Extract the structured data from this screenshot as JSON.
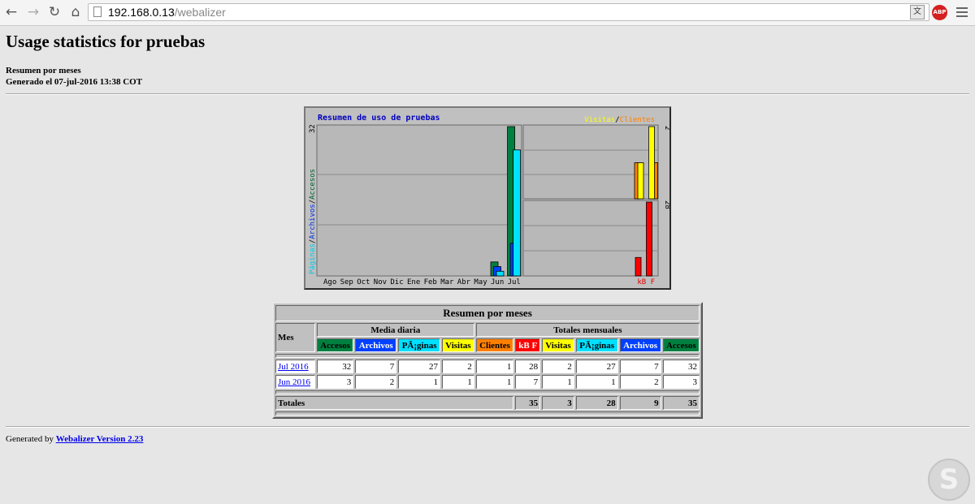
{
  "browser": {
    "url_host": "192.168.0.13",
    "url_path": "/webalizer",
    "icons": [
      "back-icon",
      "forward-icon",
      "reload-icon",
      "home-icon",
      "translate-icon",
      "adblock-icon",
      "menu-icon"
    ]
  },
  "page": {
    "title": "Usage statistics for pruebas",
    "subtitle1": "Resumen por meses",
    "subtitle2": "Generado el 07-jul-2016 13:38 COT"
  },
  "graph": {
    "title": "Resumen de uso de pruebas",
    "legend_visitas": "Visitas",
    "legend_sep": "/",
    "legend_clientes": "Clientes",
    "left_axis_paginas": "Páginas",
    "left_axis_archivos": "Archivos",
    "left_axis_accesos": "Accesos",
    "left_axis_max": "32",
    "visits_axis_max": "2",
    "kb_axis_max": "28",
    "kb_label": "kB F",
    "months": [
      "Ago",
      "Sep",
      "Oct",
      "Nov",
      "Dic",
      "Ene",
      "Feb",
      "Mar",
      "Abr",
      "May",
      "Jun",
      "Jul"
    ]
  },
  "chart_data": {
    "type": "bar",
    "title": "Resumen de uso de pruebas",
    "categories": [
      "Ago",
      "Sep",
      "Oct",
      "Nov",
      "Dic",
      "Ene",
      "Feb",
      "Mar",
      "Abr",
      "May",
      "Jun",
      "Jul"
    ],
    "panels": [
      {
        "name": "Accesos / Archivos / Páginas",
        "ylim": [
          0,
          32
        ],
        "series": [
          {
            "name": "Accesos",
            "color": "#008040",
            "values": [
              0,
              0,
              0,
              0,
              0,
              0,
              0,
              0,
              0,
              0,
              3,
              32
            ]
          },
          {
            "name": "Archivos",
            "color": "#0040ff",
            "values": [
              0,
              0,
              0,
              0,
              0,
              0,
              0,
              0,
              0,
              0,
              2,
              7
            ]
          },
          {
            "name": "Páginas",
            "color": "#00e0ff",
            "values": [
              0,
              0,
              0,
              0,
              0,
              0,
              0,
              0,
              0,
              0,
              1,
              27
            ]
          }
        ]
      },
      {
        "name": "Visitas / Clientes",
        "ylim": [
          0,
          2
        ],
        "series": [
          {
            "name": "Visitas",
            "color": "#ffff00",
            "values": [
              0,
              0,
              0,
              0,
              0,
              0,
              0,
              0,
              0,
              0,
              1,
              2
            ]
          },
          {
            "name": "Clientes",
            "color": "#ff8000",
            "values": [
              0,
              0,
              0,
              0,
              0,
              0,
              0,
              0,
              0,
              0,
              1,
              1
            ]
          }
        ]
      },
      {
        "name": "kB F",
        "ylim": [
          0,
          28
        ],
        "series": [
          {
            "name": "kB F",
            "color": "#ff0000",
            "values": [
              0,
              0,
              0,
              0,
              0,
              0,
              0,
              0,
              0,
              0,
              7,
              28
            ]
          }
        ]
      }
    ]
  },
  "table": {
    "title": "Resumen por meses",
    "mes": "Mes",
    "media_diaria": "Media diaria",
    "totales_mensuales": "Totales mensuales",
    "headers": [
      "Accesos",
      "Archivos",
      "PÃ¡ginas",
      "Visitas",
      "Clientes",
      "kB F",
      "Visitas",
      "PÃ¡ginas",
      "Archivos",
      "Accesos"
    ],
    "rows": [
      {
        "month": "Jul 2016",
        "cells": [
          "32",
          "7",
          "27",
          "2",
          "1",
          "28",
          "2",
          "27",
          "7",
          "32"
        ]
      },
      {
        "month": "Jun 2016",
        "cells": [
          "3",
          "2",
          "1",
          "1",
          "1",
          "7",
          "1",
          "1",
          "2",
          "3"
        ]
      }
    ],
    "totals_label": "Totales",
    "totals": [
      "35",
      "3",
      "28",
      "9",
      "35"
    ]
  },
  "footer": {
    "prefix": "Generated by",
    "link": "Webalizer Version 2.23"
  }
}
